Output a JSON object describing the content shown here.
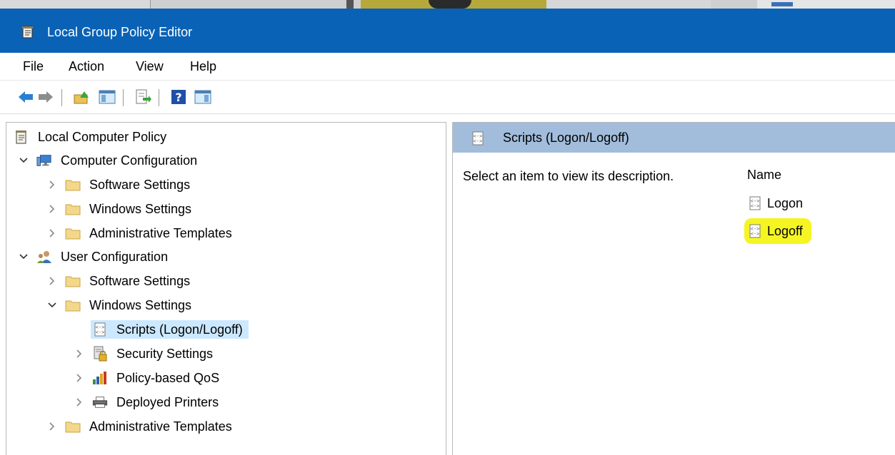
{
  "window": {
    "title": "Local Group Policy Editor",
    "app_icon": "policy-document-icon"
  },
  "menu": [
    "File",
    "Action",
    "View",
    "Help"
  ],
  "toolbar": {
    "buttons": [
      {
        "name": "back-button",
        "icon": "back-arrow-icon"
      },
      {
        "name": "forward-button",
        "icon": "forward-arrow-icon"
      },
      {
        "name": "up-one-level-button",
        "icon": "folder-up-icon"
      },
      {
        "name": "show-hide-console-tree-button",
        "icon": "console-tree-icon"
      },
      {
        "name": "export-list-button",
        "icon": "export-list-icon"
      },
      {
        "name": "help-button",
        "icon": "help-icon"
      },
      {
        "name": "show-hide-action-pane-button",
        "icon": "action-pane-icon"
      }
    ]
  },
  "tree": {
    "root": "Local Computer Policy",
    "computer_configuration": {
      "label": "Computer Configuration",
      "children": [
        "Software Settings",
        "Windows Settings",
        "Administrative Templates"
      ]
    },
    "user_configuration": {
      "label": "User Configuration",
      "software_settings": "Software Settings",
      "windows_settings": {
        "label": "Windows Settings",
        "children": [
          "Scripts (Logon/Logoff)",
          "Security Settings",
          "Policy-based QoS",
          "Deployed Printers"
        ]
      },
      "administrative_templates": "Administrative Templates"
    },
    "selected": "Scripts (Logon/Logoff)"
  },
  "details": {
    "header": "Scripts (Logon/Logoff)",
    "description": "Select an item to view its description.",
    "column_name": "Name",
    "items": [
      "Logon",
      "Logoff"
    ],
    "highlighted_item": "Logoff",
    "highlight_color": "#f5f523"
  },
  "colors": {
    "titlebar": "#0a62b6",
    "selection": "#cce8ff",
    "details_header": "#a2bddb"
  }
}
